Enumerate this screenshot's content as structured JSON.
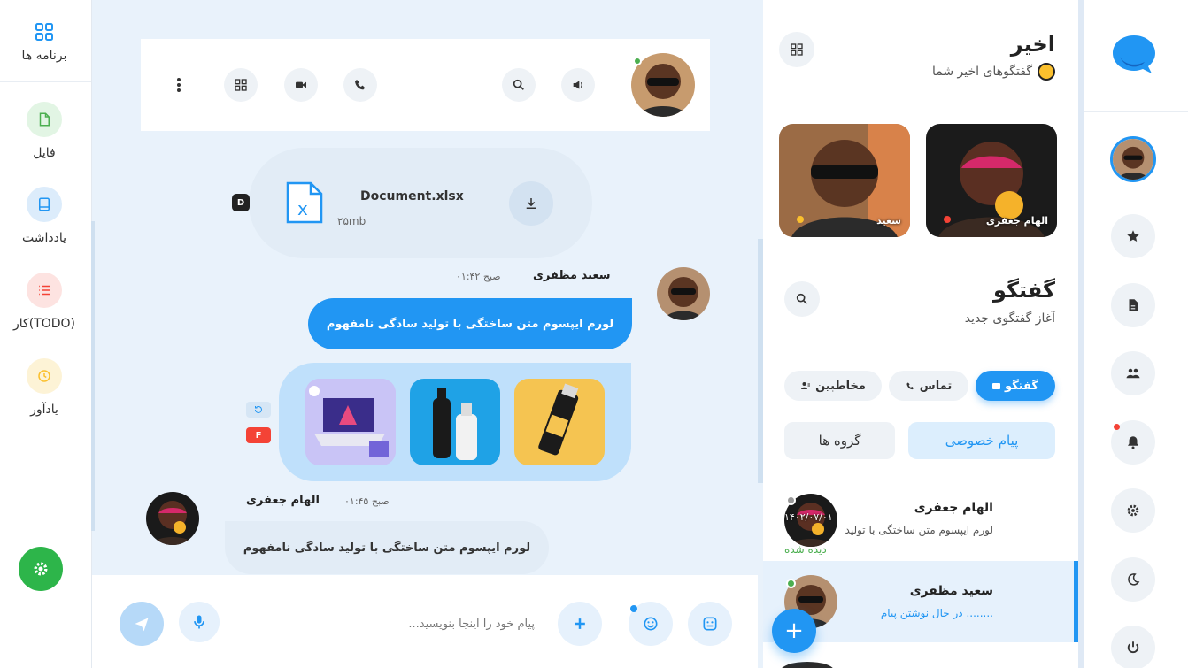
{
  "apps": {
    "title": "برنامه ها",
    "items": [
      {
        "label": "فایل",
        "icon": "file-icon",
        "color": "#4caf50",
        "bg": "#e2f5e4"
      },
      {
        "label": "یادداشت",
        "icon": "note-icon",
        "color": "#2196f3",
        "bg": "#dcecfb"
      },
      {
        "label": "کار(TODO)",
        "icon": "list-icon",
        "color": "#f44336",
        "bg": "#fde3e1"
      },
      {
        "label": "یادآور",
        "icon": "clock-icon",
        "color": "#fbc02d",
        "bg": "#fdf3d6"
      }
    ],
    "settings_color": "#2db54a"
  },
  "chat": {
    "file": {
      "name": "Document.xlsx",
      "size": "۲۵mb",
      "badge": "D"
    },
    "message1": {
      "sender": "سعید مظفری",
      "time": "۰۱:۴۲ صبح",
      "text": "لورم ایپسوم متن ساختگی با تولید سادگی نامفهوم"
    },
    "gallery": {
      "badge_f": "F"
    },
    "message2": {
      "sender": "الهام جعفری",
      "time": "صبح ۰۱:۴۵",
      "text": "لورم ایپسوم متن ساختگی با تولید سادگی نامفهوم"
    }
  },
  "composer": {
    "placeholder": "پیام خود را اینجا بنویسید..."
  },
  "recent": {
    "title": "اخیر",
    "subtitle": "گفتگوهای اخیر شما",
    "stories": [
      {
        "name": "الهام جعفری",
        "dot": "#f44336"
      },
      {
        "name": "سعید",
        "dot": "#fbc02d"
      }
    ]
  },
  "conversations": {
    "title": "گفتگو",
    "subtitle": "آغاز گفتگوی جدید",
    "tabs": [
      {
        "label": "گفتگو",
        "active": true
      },
      {
        "label": "تماس",
        "active": false
      },
      {
        "label": "مخاطبین",
        "active": false
      }
    ],
    "segments": {
      "private": "پیام خصوصی",
      "groups": "گروه ها"
    },
    "items": [
      {
        "name": "الهام جعفری",
        "preview": "لورم ایپسوم متن ساختگی با تولید",
        "date": "۱۴۰۲/۰۷/۰۱",
        "status": "دیده شده"
      },
      {
        "name": "سعید مظفری",
        "preview": "در حال نوشتن پیام ........",
        "status": ""
      }
    ]
  },
  "colors": {
    "accent": "#2196f3",
    "online": "#4caf50",
    "seen": "#4caf50"
  }
}
